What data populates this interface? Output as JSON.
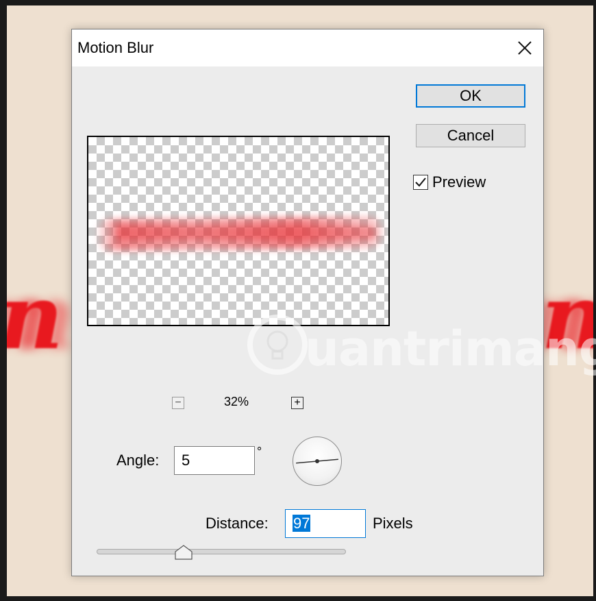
{
  "dialog": {
    "title": "Motion Blur",
    "ok_label": "OK",
    "cancel_label": "Cancel",
    "preview_label": "Preview",
    "preview_checked": true
  },
  "zoom": {
    "level": "32%",
    "minus": "−",
    "plus": "+"
  },
  "angle": {
    "label": "Angle:",
    "value": "5",
    "unit": "°"
  },
  "distance": {
    "label": "Distance:",
    "value": "97",
    "unit": "Pixels",
    "slider_fraction": 0.35
  },
  "background": {
    "left_text": "n",
    "right_text": "ng",
    "watermark": "uantrimang"
  },
  "colors": {
    "accent": "#0078d7",
    "blur_red": "#e8191f"
  },
  "icons": {
    "close": "close-icon",
    "check": "check-icon",
    "dial": "angle-dial-icon",
    "watermark": "lightbulb-icon"
  }
}
